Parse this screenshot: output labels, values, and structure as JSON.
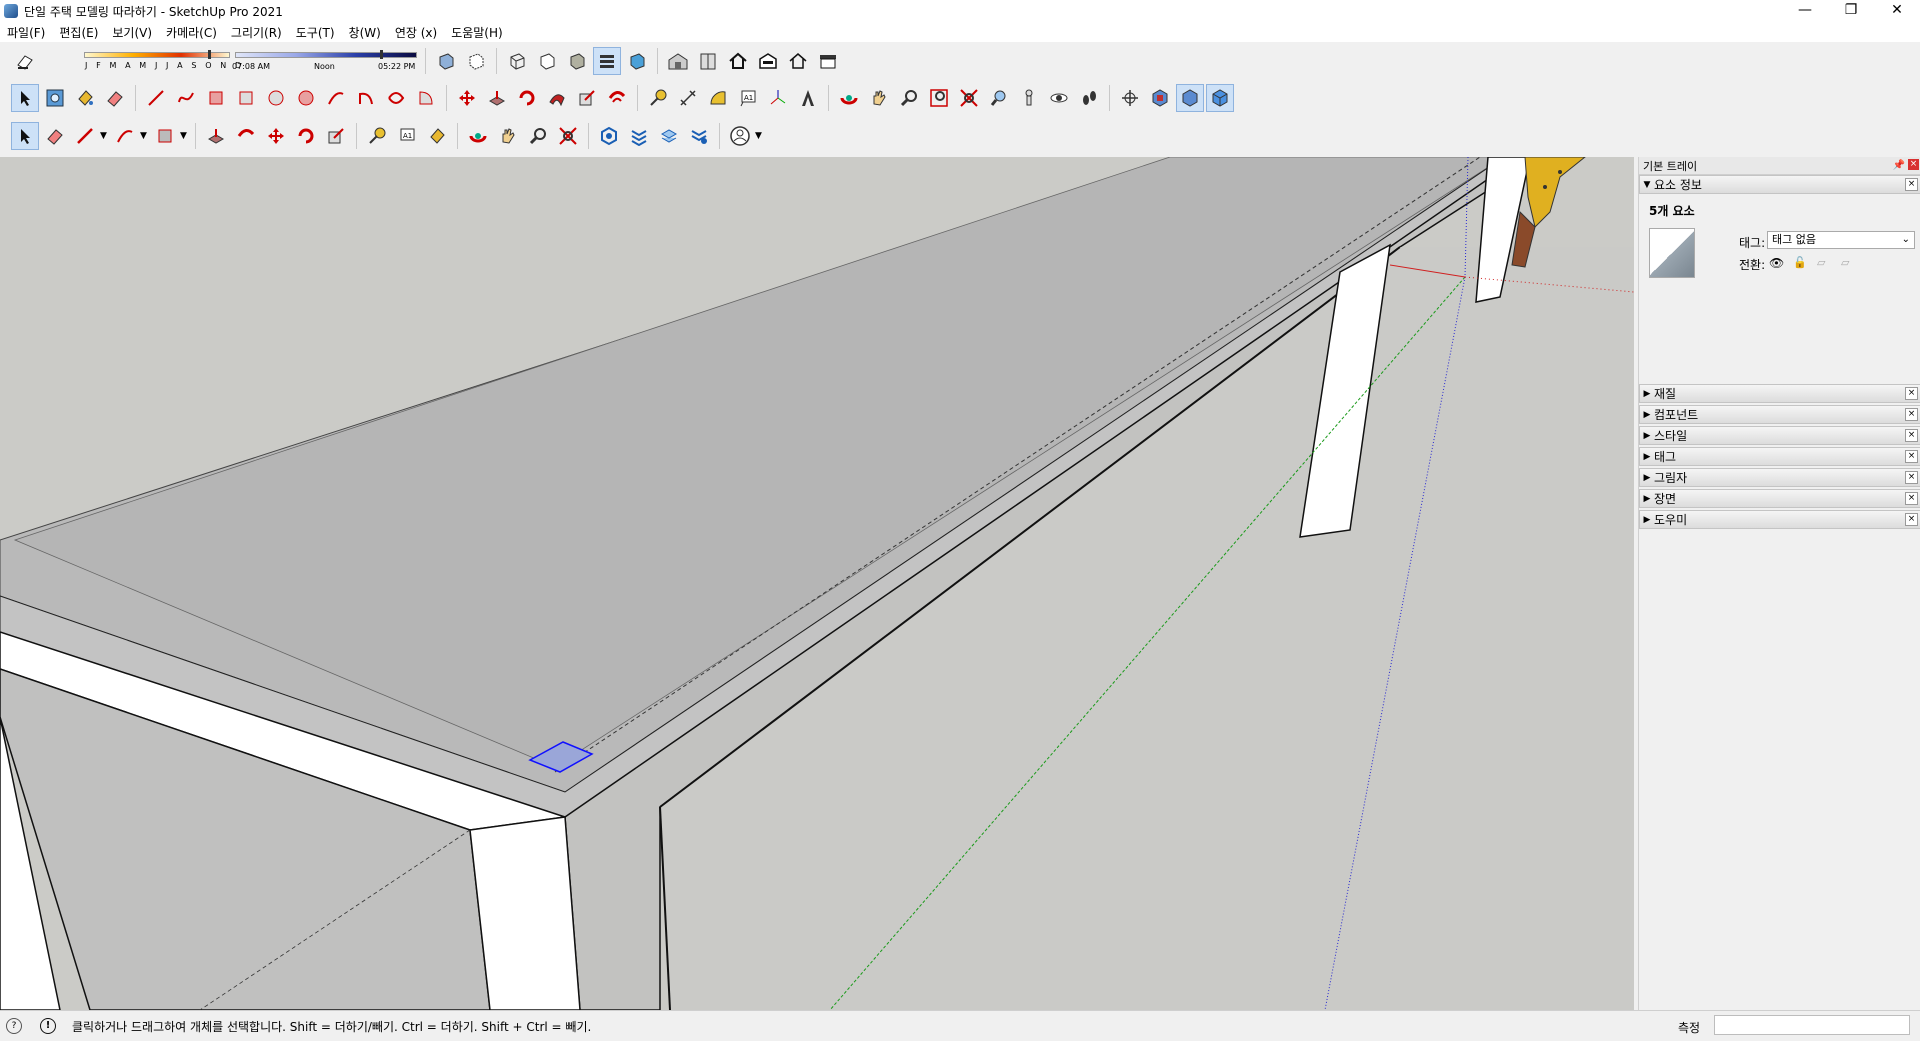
{
  "window": {
    "title": "단일 주택 모델링 따라하기 - SketchUp Pro 2021",
    "controls": [
      "—",
      "❐",
      "✕"
    ]
  },
  "menu": [
    "파일(F)",
    "편집(E)",
    "보기(V)",
    "카메라(C)",
    "그리기(R)",
    "도구(T)",
    "창(W)",
    "연장 (x)",
    "도움말(H)"
  ],
  "shadows": {
    "months": "J F M A M J J A S O N D",
    "time_start": "07:08 AM",
    "time_mid": "Noon",
    "time_end": "05:22 PM"
  },
  "tray": {
    "title": "기본 트레이",
    "entity_panel": {
      "header": "요소 정보",
      "count": "5개 요소",
      "tag_label": "태그:",
      "tag_value": "태그 없음",
      "toggle_label": "전환:"
    },
    "panels": [
      "재질",
      "컴포넌트",
      "스타일",
      "태그",
      "그림자",
      "장면",
      "도우미"
    ]
  },
  "status": {
    "message": "클릭하거나 드래그하여 개체를 선택합니다. Shift = 더하기/빼기. Ctrl = 더하기. Shift + Ctrl = 빼기.",
    "measure_label": "측정"
  }
}
